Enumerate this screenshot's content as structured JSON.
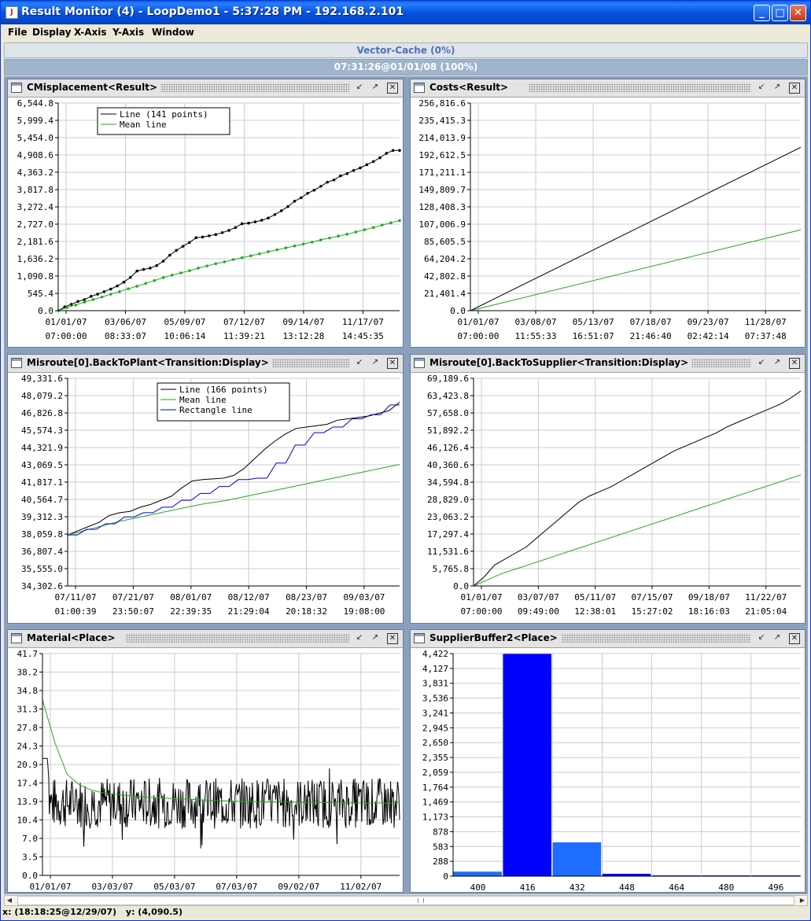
{
  "window": {
    "title": "Result Monitor (4) - LoopDemo1 - 5:37:28 PM - 192.168.2.101",
    "app_icon": "java-icon",
    "controls": [
      "minimize",
      "maximize",
      "close"
    ]
  },
  "menu": [
    "File",
    "Display",
    "X-Axis",
    "Y-Axis",
    "Window"
  ],
  "cache_bar": "Vector-Cache  (0%)",
  "progress_bar": "07:31:26@01/01/08  (100%)",
  "status": {
    "x": "x: (18:18:25@12/29/07)",
    "y": "y: (4,090.5)"
  },
  "colors": {
    "line": "#000000",
    "mean": "#22aa22",
    "rect": "#0000cc",
    "bar": "#0000ff",
    "bar_light": "#1e6dff"
  },
  "panels": [
    {
      "title": "CMisplacement<Result>",
      "chart_data": {
        "type": "line",
        "yticks": [
          "6,544.8",
          "5,999.4",
          "5,454.0",
          "4,908.6",
          "4,363.2",
          "3,817.8",
          "3,272.4",
          "2,727.0",
          "2,181.6",
          "1,636.2",
          "1,090.8",
          "545.4",
          "0.0"
        ],
        "ylim": [
          0,
          6544.8
        ],
        "xticks": [
          [
            "01/01/07",
            "07:00:00"
          ],
          [
            "03/06/07",
            "08:33:07"
          ],
          [
            "05/09/07",
            "10:06:14"
          ],
          [
            "07/12/07",
            "11:39:21"
          ],
          [
            "09/14/07",
            "13:12:28"
          ],
          [
            "11/17/07",
            "14:45:35"
          ]
        ],
        "legend": [
          "Line (141 points)",
          "Mean line"
        ],
        "series": [
          {
            "name": "Line (141 points)",
            "color": "#000000",
            "markers": true,
            "values": [
              0,
              120,
              200,
              290,
              350,
              450,
              520,
              600,
              680,
              780,
              900,
              1050,
              1250,
              1300,
              1340,
              1420,
              1560,
              1750,
              1900,
              2030,
              2150,
              2300,
              2320,
              2360,
              2400,
              2460,
              2530,
              2620,
              2740,
              2760,
              2800,
              2850,
              2920,
              3030,
              3150,
              3280,
              3450,
              3560,
              3700,
              3800,
              3920,
              4050,
              4120,
              4250,
              4320,
              4420,
              4500,
              4600,
              4700,
              4820,
              4960,
              5050,
              5050
            ]
          },
          {
            "name": "Mean line",
            "color": "#22aa22",
            "markers": true,
            "values": [
              0,
              100,
              180,
              270,
              350,
              430,
              520,
              600,
              690,
              770,
              860,
              950,
              1040,
              1120,
              1190,
              1260,
              1340,
              1410,
              1480,
              1540,
              1610,
              1670,
              1730,
              1790,
              1860,
              1920,
              1980,
              2040,
              2100,
              2160,
              2230,
              2290,
              2350,
              2410,
              2480,
              2550,
              2620,
              2700,
              2770,
              2840
            ]
          }
        ]
      }
    },
    {
      "title": "Costs<Result>",
      "chart_data": {
        "type": "line",
        "yticks": [
          "256,816.6",
          "235,415.3",
          "214,013.9",
          "192,612.5",
          "171,211.1",
          "149,809.7",
          "128,408.3",
          "107,006.9",
          "85,605.5",
          "64,204.2",
          "42,802.8",
          "21,401.4",
          "0.0"
        ],
        "ylim": [
          0,
          256816.6
        ],
        "xticks": [
          [
            "01/01/07",
            "07:00:00"
          ],
          [
            "03/08/07",
            "11:55:33"
          ],
          [
            "05/13/07",
            "16:51:07"
          ],
          [
            "07/18/07",
            "21:46:40"
          ],
          [
            "09/23/07",
            "02:42:14"
          ],
          [
            "11/28/07",
            "07:37:48"
          ]
        ],
        "series": [
          {
            "name": "",
            "color": "#000000",
            "values": [
              0,
              202000
            ]
          },
          {
            "name": "",
            "color": "#22aa22",
            "values": [
              0,
              100000
            ]
          }
        ]
      }
    },
    {
      "title": "Misroute[0].BackToPlant<Transition:Display>",
      "chart_data": {
        "type": "line",
        "yticks": [
          "49,331.6",
          "48,079.2",
          "46,826.8",
          "45,574.3",
          "44,321.9",
          "43,069.5",
          "41,817.1",
          "40,564.7",
          "39,312.3",
          "38,059.8",
          "36,807.4",
          "35,555.0",
          "34,302.6"
        ],
        "ylim": [
          34302.6,
          49331.6
        ],
        "xticks": [
          [
            "07/11/07",
            "01:00:39"
          ],
          [
            "07/21/07",
            "23:50:07"
          ],
          [
            "08/01/07",
            "22:39:35"
          ],
          [
            "08/12/07",
            "21:29:04"
          ],
          [
            "08/23/07",
            "20:18:32"
          ],
          [
            "09/03/07",
            "19:08:00"
          ]
        ],
        "legend": [
          "Line (166 points)",
          "Mean line",
          "Rectangle line"
        ],
        "series": [
          {
            "name": "Line (166 points)",
            "color": "#000000",
            "values": [
              38000,
              38300,
              38600,
              38900,
              39400,
              39600,
              39700,
              40000,
              40200,
              40500,
              40800,
              41400,
              41900,
              42000,
              42050,
              42100,
              42300,
              42800,
              43500,
              44200,
              44800,
              45300,
              45700,
              45800,
              45900,
              46000,
              46300,
              46400,
              46500,
              46600,
              46800,
              47000,
              47600
            ]
          },
          {
            "name": "Mean line",
            "color": "#22aa22",
            "values": [
              38000,
              38250,
              38500,
              38750,
              39000,
              39200,
              39400,
              39600,
              39800,
              40000,
              40200,
              40350,
              40500,
              40700,
              40900,
              41100,
              41300,
              41500,
              41700,
              41900,
              42100,
              42300,
              42500,
              42700,
              42900,
              43100
            ]
          },
          {
            "name": "Rectangle line",
            "color": "#0000cc",
            "values": [
              38000,
              38000,
              38400,
              38400,
              38800,
              38800,
              39300,
              39300,
              39600,
              39600,
              40000,
              40000,
              40500,
              40500,
              41000,
              41000,
              41500,
              41500,
              42000,
              42000,
              42100,
              42100,
              43200,
              43200,
              44500,
              44500,
              45400,
              45400,
              45800,
              45800,
              46400,
              46400,
              46700,
              46700,
              47400,
              47400
            ]
          }
        ]
      }
    },
    {
      "title": "Misroute[0].BackToSupplier<Transition:Display>",
      "chart_data": {
        "type": "line",
        "yticks": [
          "69,189.6",
          "63,423.8",
          "57,658.0",
          "51,892.2",
          "46,126.4",
          "40,360.6",
          "34,594.8",
          "28,829.0",
          "23,063.2",
          "17,297.4",
          "11,531.6",
          "5,765.8",
          "0.0"
        ],
        "ylim": [
          0,
          69189.6
        ],
        "xticks": [
          [
            "01/01/07",
            "07:00:00"
          ],
          [
            "03/07/07",
            "09:49:00"
          ],
          [
            "05/11/07",
            "12:38:01"
          ],
          [
            "07/15/07",
            "15:27:02"
          ],
          [
            "09/18/07",
            "18:16:03"
          ],
          [
            "11/22/07",
            "21:05:04"
          ]
        ],
        "series": [
          {
            "name": "",
            "color": "#000000",
            "values": [
              0,
              3000,
              7000,
              9000,
              11000,
              13000,
              16000,
              19000,
              22000,
              25000,
              28000,
              30000,
              31500,
              33000,
              35000,
              37000,
              39000,
              41000,
              43000,
              45000,
              46500,
              48000,
              49500,
              51000,
              53000,
              54500,
              56000,
              57500,
              59000,
              60500,
              62500,
              65000
            ]
          },
          {
            "name": "",
            "color": "#22aa22",
            "values": [
              0,
              2000,
              4000,
              5500,
              7000,
              8500,
              10000,
              11500,
              13000,
              14500,
              16000,
              17500,
              19000,
              20500,
              22000,
              23500,
              25000,
              26500,
              28000,
              29500,
              31000,
              32500,
              34000,
              35500,
              37000
            ]
          }
        ]
      }
    },
    {
      "title": "Material<Place>",
      "chart_data": {
        "type": "line",
        "yticks": [
          "41.7",
          "38.2",
          "34.8",
          "31.3",
          "27.8",
          "24.3",
          "20.9",
          "17.4",
          "13.9",
          "10.4",
          "7.0",
          "3.5",
          "0.0"
        ],
        "ylim": [
          0,
          41.7
        ],
        "xticks": [
          [
            "01/01/07",
            "07:00:00"
          ],
          [
            "03/03/07",
            "09:25:54"
          ],
          [
            "05/03/07",
            "11:51:48"
          ],
          [
            "07/03/07",
            "14:17:42"
          ],
          [
            "09/02/07",
            "16:43:36"
          ],
          [
            "11/02/07",
            "19:09:30"
          ]
        ],
        "series": [
          {
            "name": "",
            "color": "#000000",
            "noise": true,
            "mean": 13.6,
            "spread": 4.8,
            "start": 33
          },
          {
            "name": "",
            "color": "#22aa22",
            "values": [
              33,
              25,
              19,
              17,
              16,
              15.5,
              15.2,
              15,
              14.8,
              14.6,
              14.5,
              14.4,
              14.3,
              14.2,
              14.1,
              14.0,
              13.9,
              13.9,
              13.8,
              13.8,
              13.8,
              13.7,
              13.7,
              13.7,
              13.7,
              13.6,
              13.6,
              13.6,
              13.6,
              13.6
            ]
          }
        ]
      }
    },
    {
      "title": "SupplierBuffer2<Place>",
      "chart_data": {
        "type": "bar",
        "yticks": [
          "4,422",
          "4,127",
          "3,831",
          "3,536",
          "3,241",
          "2,945",
          "2,650",
          "2,355",
          "2,059",
          "1,764",
          "1,469",
          "1,173",
          "878",
          "583",
          "288",
          "0"
        ],
        "ylim": [
          0,
          4712
        ],
        "categories": [
          "400",
          "416",
          "432",
          "448",
          "464",
          "480",
          "496"
        ],
        "values": [
          100,
          4712,
          720,
          55,
          20,
          20,
          20
        ],
        "highlight": [
          false,
          true,
          false,
          true,
          true,
          true,
          true
        ]
      }
    }
  ]
}
